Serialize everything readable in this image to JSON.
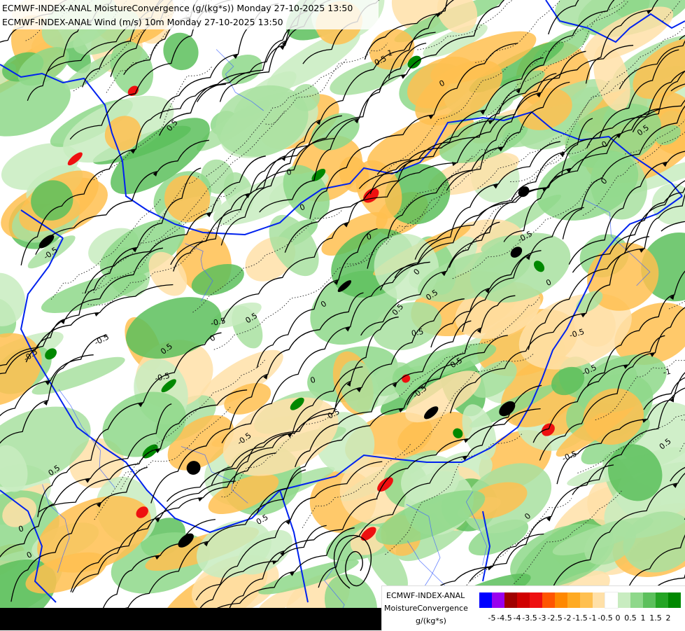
{
  "title_line1": "ECMWF-INDEX-ANAL MoistureConvergence (g/(kg*s)) Monday 27-10-2025 13:50",
  "title_line2": "ECMWF-INDEX-ANAL Wind (m/s) 10m Monday 27-10-2025 13:50",
  "legend": {
    "line1": "ECMWF-INDEX-ANAL",
    "line2": "MoistureConvergence",
    "line3": "g/(kg*s)",
    "colors": [
      "#0000ff",
      "#9900ee",
      "#a00000",
      "#d00000",
      "#ee1010",
      "#ff5500",
      "#ff8800",
      "#ffaa22",
      "#ffc050",
      "#ffe0a8",
      "#ffffff",
      "#c8ecc0",
      "#8ed88a",
      "#5cc05c",
      "#24a424",
      "#008800"
    ],
    "ticks": [
      "-5",
      "-4.5",
      "-4",
      "-3.5",
      "-3",
      "-2.5",
      "-2",
      "-1.5",
      "-1",
      "-0.5",
      "0",
      "0.5",
      "1",
      "1.5",
      "2"
    ]
  },
  "contour_labels": [
    "0",
    "0.5",
    "-0.5",
    "1",
    "-1",
    "0.5",
    "0",
    "-0.5",
    "0",
    "0.5",
    "-0.5",
    "0",
    "0.5",
    "0",
    "-0.5",
    "0.5",
    "0",
    "-0.5",
    "0",
    "0.5",
    "-0.5",
    "0.5",
    "0",
    "-0.5",
    "0",
    "0.5",
    "0",
    "-0.5",
    "0.5",
    "0",
    "0.5",
    "-0.5",
    "0",
    "0.5",
    "-0.5",
    "0",
    "0.5",
    "-0.5",
    "0",
    "0.5"
  ]
}
